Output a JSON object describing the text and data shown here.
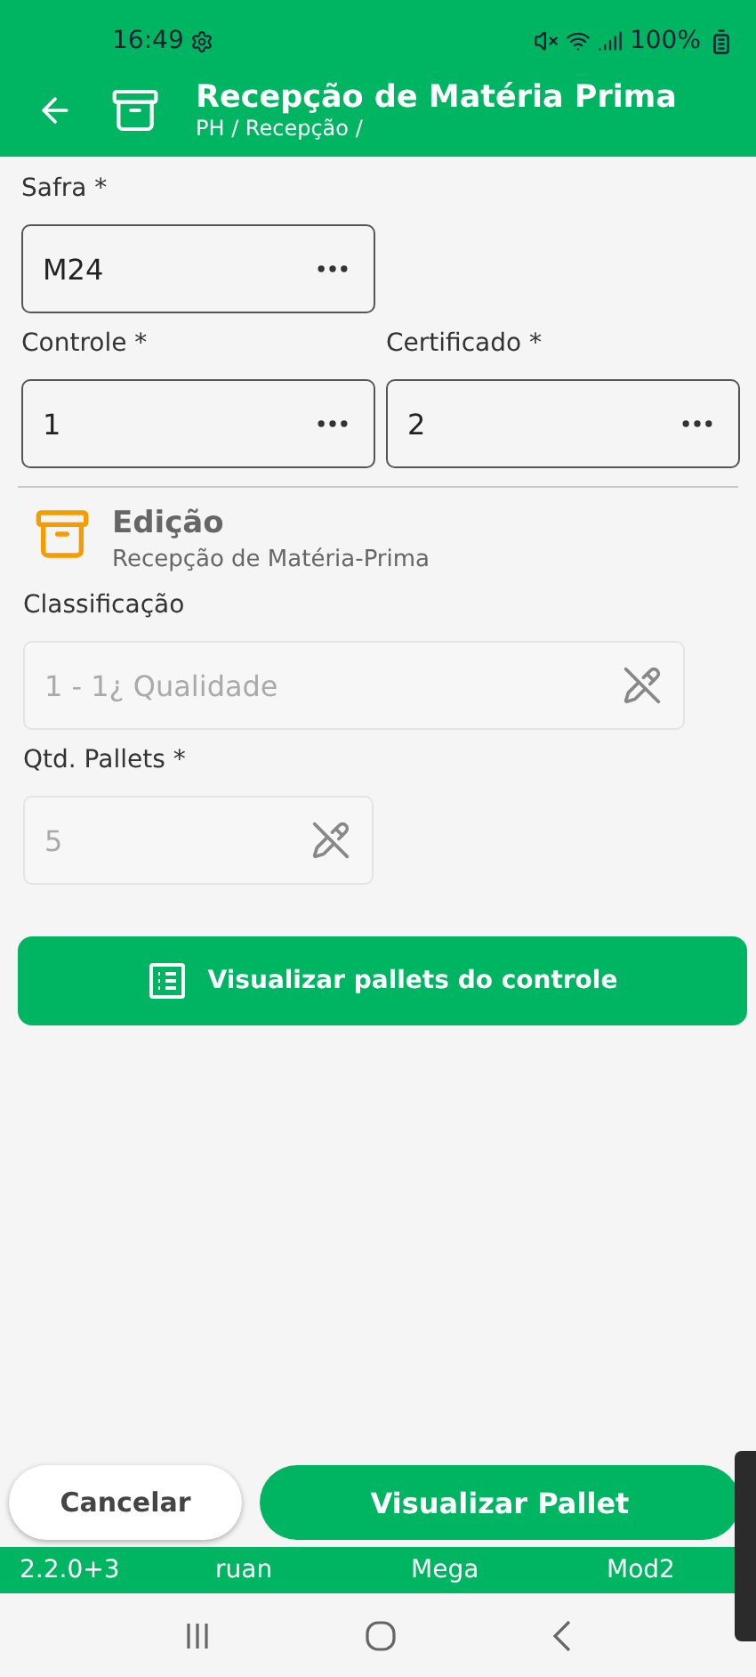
{
  "status_bar": {
    "time": "16:49",
    "battery": "100%"
  },
  "app_bar": {
    "title": "Recepção de Matéria Prima",
    "breadcrumb": "PH / Recepção /"
  },
  "header_fields": [
    {
      "label": "Safra *",
      "value": "M24"
    },
    {
      "label": "Controle *",
      "value": "1"
    },
    {
      "label": "Certificado *",
      "value": "2"
    }
  ],
  "section": {
    "title": "Edição",
    "subtitle": "Recepção de Matéria-Prima"
  },
  "edit_fields": [
    {
      "label": "Classificação",
      "value": "1 - 1¿ Qualidade",
      "disabled": true
    },
    {
      "label": "Qtd. Pallets *",
      "value": "5",
      "disabled": true
    }
  ],
  "view_button": "Visualizar pallets do controle",
  "actions": {
    "cancel": "Cancelar",
    "primary": "Visualizar Pallet"
  },
  "footer": [
    "2.2.0+3",
    "ruan",
    "Mega",
    "Mod2"
  ]
}
